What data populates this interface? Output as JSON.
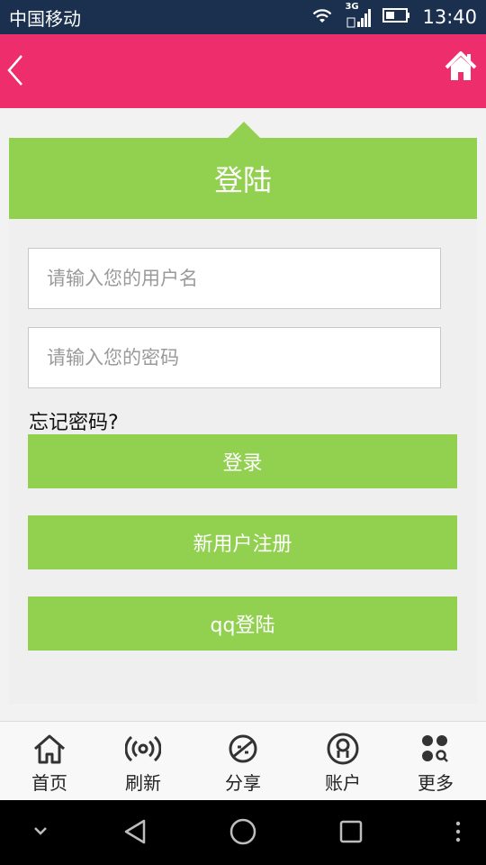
{
  "status_bar": {
    "carrier": "中国移动",
    "network_type": "3G",
    "time": "13:40",
    "icons": [
      "wifi-icon",
      "signal-icon",
      "battery-icon"
    ]
  },
  "header": {
    "back_icon": "chevron-left-icon",
    "home_icon": "home-icon",
    "background_color": "#ee2e6c"
  },
  "login_card": {
    "title": "登陆",
    "username_placeholder": "请输入您的用户名",
    "username_value": "",
    "password_placeholder": "请输入您的密码",
    "password_value": "",
    "forgot_password": "忘记密码?",
    "login_button": "登录",
    "register_button": "新用户注册",
    "qq_login_button": "qq登陆",
    "accent_color": "#92d050"
  },
  "tab_bar": {
    "tabs": [
      {
        "label": "首页",
        "icon": "home-icon"
      },
      {
        "label": "刷新",
        "icon": "refresh-broadcast-icon"
      },
      {
        "label": "分享",
        "icon": "share-planet-icon"
      },
      {
        "label": "账户",
        "icon": "account-icon"
      },
      {
        "label": "更多",
        "icon": "more-icon"
      }
    ]
  },
  "nav_bar": {
    "icons": [
      "chevron-down-icon",
      "back-triangle-icon",
      "home-circle-icon",
      "recents-square-icon",
      "overflow-dots-icon"
    ]
  }
}
